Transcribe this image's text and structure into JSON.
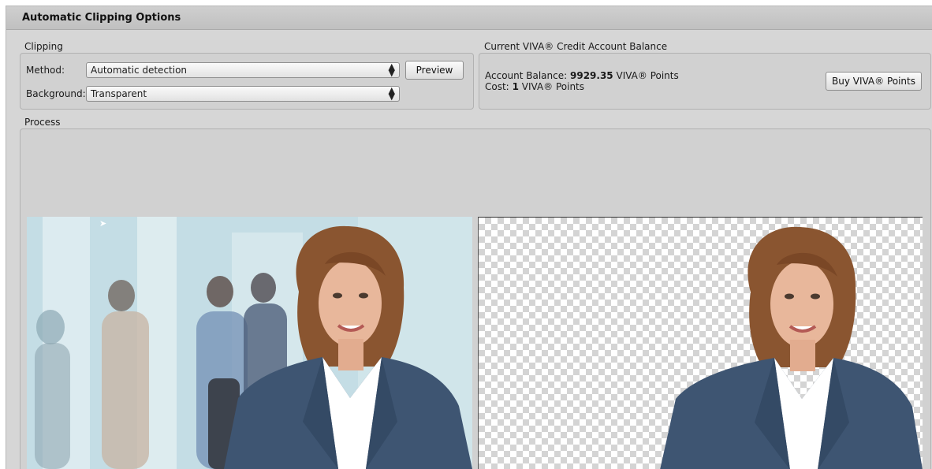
{
  "window": {
    "title": "Automatic Clipping Options"
  },
  "clipping": {
    "section_label": "Clipping",
    "method_label": "Method:",
    "method_value": "Automatic detection",
    "background_label": "Background:",
    "background_value": "Transparent",
    "preview_button": "Preview"
  },
  "account": {
    "section_label": "Current VIVA® Credit Account Balance",
    "balance_prefix": "Account Balance:",
    "balance_value": "9929.35",
    "balance_unit": "VIVA® Points",
    "cost_prefix": "Cost:",
    "cost_value": "1",
    "cost_unit": "VIVA® Points",
    "buy_button": "Buy VIVA® Points"
  },
  "process": {
    "section_label": "Process",
    "original_image": "portrait-original",
    "clipped_image": "portrait-transparent"
  },
  "colors": {
    "dialog_bg": "#d6d6d6",
    "groupbox_bg": "#d1d1d1",
    "checker_dark": "#d4d4d4"
  }
}
